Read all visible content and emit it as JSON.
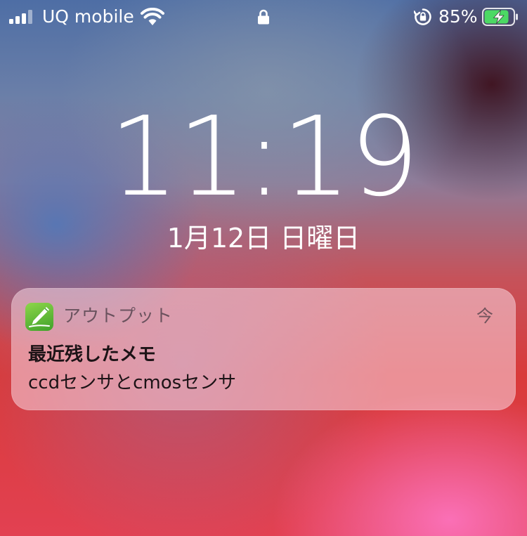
{
  "status_bar": {
    "carrier": "UQ mobile",
    "battery_percent": "85%",
    "signal_bars_filled": 3,
    "signal_bars_total": 4,
    "battery_level": 0.85,
    "battery_charging": true,
    "battery_color": "#4cd964",
    "icons": [
      "signal-bars-icon",
      "wifi-icon",
      "lock-icon",
      "rotation-lock-icon",
      "battery-charging-icon"
    ]
  },
  "lock_screen": {
    "time": "11:19",
    "date": "1月12日 日曜日"
  },
  "notification": {
    "app_icon": "pen-app-icon",
    "app_icon_color": "#5cbf34",
    "app_name": "アウトプット",
    "timestamp": "今",
    "title": "最近残したメモ",
    "body": "ccdセンサとcmosセンサ"
  }
}
